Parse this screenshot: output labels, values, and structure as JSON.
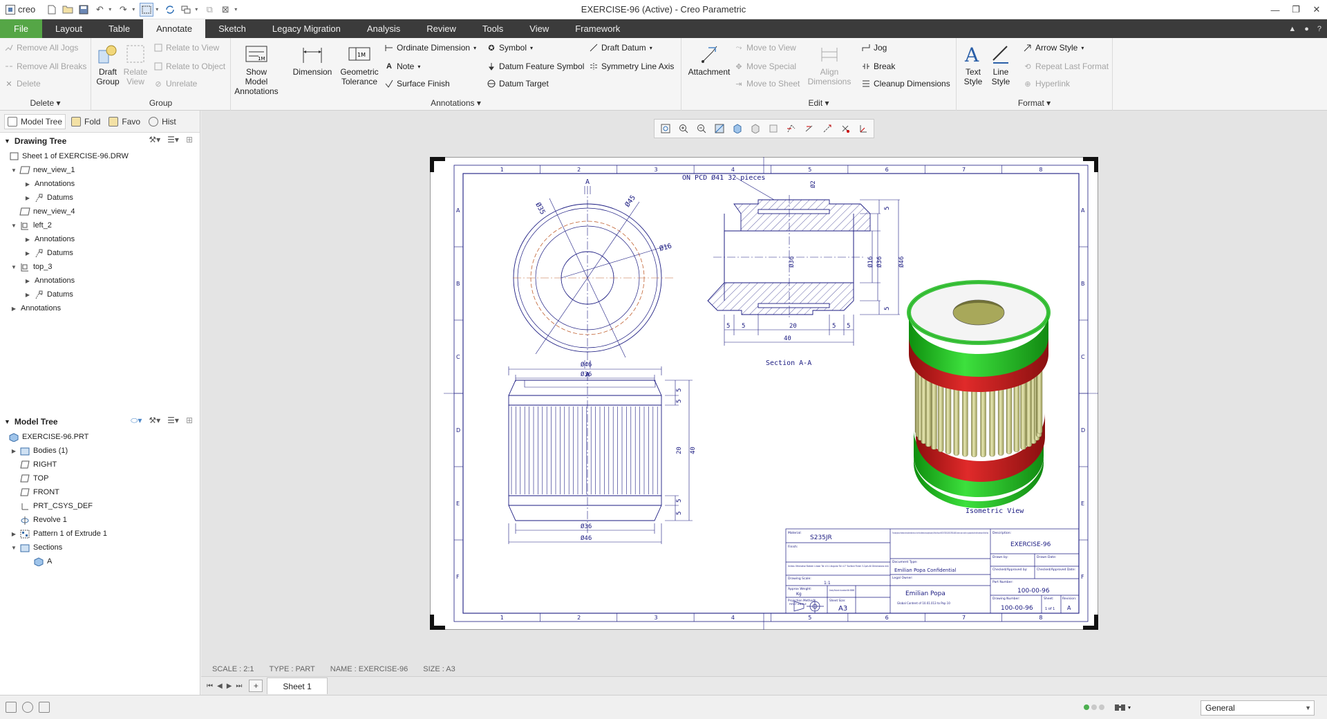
{
  "app": {
    "logo_text": "creo",
    "window_title": "EXERCISE-96 (Active) - Creo Parametric"
  },
  "menu": {
    "tabs": [
      "File",
      "Layout",
      "Table",
      "Annotate",
      "Sketch",
      "Legacy Migration",
      "Analysis",
      "Review",
      "Tools",
      "View",
      "Framework"
    ],
    "active": "Annotate"
  },
  "ribbon": {
    "delete": {
      "remove_all_jogs": "Remove All Jogs",
      "remove_all_breaks": "Remove All Breaks",
      "delete": "Delete",
      "label": "Delete"
    },
    "group": {
      "draft_group": "Draft Group",
      "relate_view": "Relate View",
      "relate_to_view": "Relate to View",
      "relate_to_object": "Relate to Object",
      "unrelate": "Unrelate",
      "label": "Group"
    },
    "annotations": {
      "show_model_annotations": "Show Model Annotations",
      "dimension": "Dimension",
      "geometric_tolerance": "Geometric Tolerance",
      "ordinate_dimension": "Ordinate Dimension",
      "note": "Note",
      "surface_finish": "Surface Finish",
      "symbol": "Symbol",
      "datum_feature_symbol": "Datum Feature Symbol",
      "datum_target": "Datum Target",
      "draft_datum": "Draft Datum",
      "symmetry_line_axis": "Symmetry Line Axis",
      "label": "Annotations"
    },
    "edit": {
      "attachment": "Attachment",
      "move_to_view": "Move to View",
      "move_special": "Move Special",
      "move_to_sheet": "Move to Sheet",
      "align_dimensions": "Align Dimensions",
      "jog": "Jog",
      "break": "Break",
      "cleanup_dimensions": "Cleanup Dimensions",
      "label": "Edit"
    },
    "format": {
      "text_style": "Text Style",
      "line_style": "Line Style",
      "arrow_style": "Arrow Style",
      "repeat_last_format": "Repeat Last Format",
      "hyperlink": "Hyperlink",
      "label": "Format"
    }
  },
  "panel": {
    "tabs": [
      "Model Tree",
      "Fold",
      "Favo",
      "Hist"
    ],
    "drawing_tree": {
      "title": "Drawing Tree",
      "items": [
        "Sheet 1 of EXERCISE-96.DRW",
        "new_view_1",
        "Annotations",
        "Datums",
        "new_view_4",
        "left_2",
        "Annotations",
        "Datums",
        "top_3",
        "Annotations",
        "Datums",
        "Annotations"
      ]
    },
    "model_tree": {
      "title": "Model Tree",
      "items": [
        "EXERCISE-96.PRT",
        "Bodies (1)",
        "RIGHT",
        "TOP",
        "FRONT",
        "PRT_CSYS_DEF",
        "Revolve 1",
        "Pattern 1 of Extrude 1",
        "Sections",
        "A"
      ]
    }
  },
  "drawing": {
    "zone_cols": [
      "1",
      "2",
      "3",
      "4",
      "5",
      "6",
      "7",
      "8"
    ],
    "zone_rows": [
      "A",
      "B",
      "C",
      "D",
      "E",
      "F"
    ],
    "top_view": {
      "cut": "A",
      "d35": "Ø35",
      "d45": "Ø45",
      "d16": "Ø16"
    },
    "section": {
      "note": "ON PCD Ø41 32 pieces",
      "d2": "Ø2",
      "d36": "Ø36",
      "d16": "Ø16",
      "d36b": "Ø36",
      "d46": "Ø46",
      "d5a": "5",
      "d5b": "5",
      "d5c": "5",
      "d5d": "5",
      "d20": "20",
      "d5e": "5",
      "d5f": "5",
      "d40": "40",
      "title": "Section A-A"
    },
    "front_view": {
      "d46a": "Ø46",
      "d36a": "Ø36",
      "d36b": "Ø36",
      "d46b": "Ø46",
      "v5a": "5",
      "v5b": "5",
      "v20": "20",
      "v5c": "5",
      "v5d": "5",
      "v40": "40"
    },
    "iso_label": "Isometric View",
    "title_block": {
      "material_label": "Material:",
      "material": "S235JR",
      "finish_label": "Finish:",
      "tolerances": "Unless Otherwise Stated: Linear Tol ±0.1 Angular Tol ±1° Surface Finish 3.2µm All Dimensions mm",
      "drawing_scale_label": "Drawing Scale:",
      "drawing_scale": "1:1",
      "approx_weight_label": "Approx Weight:",
      "approx_weight": "Kg",
      "drawing_produced": "Drawing Produced in Accordance With: BS8888",
      "projection_label": "Projection Method:",
      "projection": "FIRST ANGLE",
      "sheet_size_label": "Sheet Size:",
      "sheet_size": "A3",
      "confidential_note": "This drawing and any information or descriptive matter set out on it are the confidential and copyright property of Emilian Popa and MUST NOT BE DISCLOSED COPIED LOANED in whole or part or used for any purpose without the written permission of Emilian Popa",
      "document_type_label": "Document Type:",
      "confidential": "Emilian Popa Confidential",
      "legal_owner_label": "Legal Owner:",
      "legal_owner": "Emilian Popa",
      "legal_owner_sub": "Global Content of 10.01.013 to Pop 10",
      "description_label": "Description:",
      "description": "EXERCISE-96",
      "drawn_by_label": "Drawn by:",
      "drawn_date_label": "Drawn Date:",
      "checked_label": "Checked/Approved by:",
      "checked_date_label": "Checked/Approved Date:",
      "part_number_label": "Part Number:",
      "part_number": "100-00-96",
      "drawing_number_label": "Drawing Number:",
      "drawing_number": "100-00-96",
      "sheet_label": "Sheet:",
      "sheet": "1 of 1",
      "revision_label": "Revision:",
      "revision": "A"
    }
  },
  "status": {
    "scale": "SCALE : 2:1",
    "type": "TYPE : PART",
    "name": "NAME : EXERCISE-96",
    "size": "SIZE : A3"
  },
  "sheet_tab": "Sheet 1",
  "filter": {
    "value": "General"
  },
  "colors": {
    "accent_green": "#55a646",
    "menubar": "#3b3b3b",
    "drawing_line": "#1a1a80",
    "iso_green": "#1db81d",
    "iso_red": "#c41616",
    "iso_pin": "#c9c97e"
  }
}
